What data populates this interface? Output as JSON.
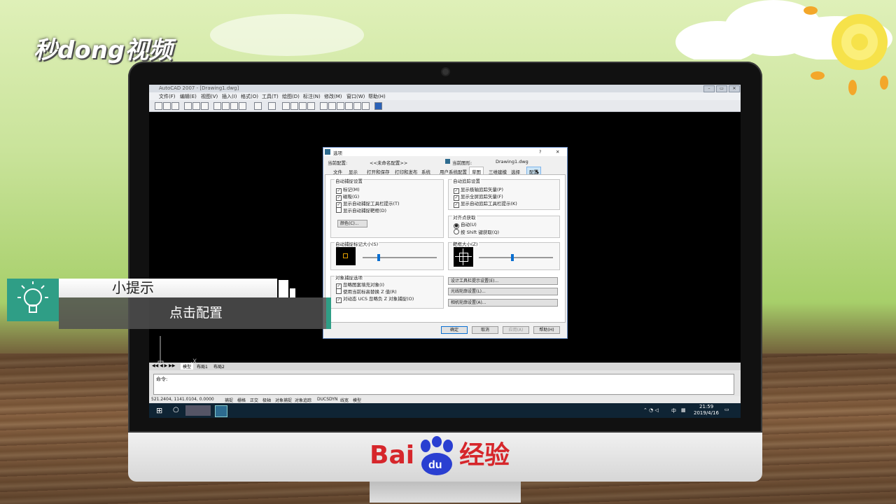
{
  "brand": {
    "logo_text": "秒dong视频",
    "footer_text": "经验",
    "footer_brand": "Bai"
  },
  "app": {
    "window_title": "AutoCAD 2007 - [Drawing1.dwg]",
    "menu": [
      "文件(F)",
      "编辑(E)",
      "视图(V)",
      "插入(I)",
      "格式(O)",
      "工具(T)",
      "绘图(D)",
      "标注(N)",
      "修改(M)",
      "窗口(W)",
      "帮助(H)"
    ],
    "axis_x_label": "X",
    "layout_tabs": [
      "模型",
      "布局1",
      "布局2"
    ],
    "command_prompt": "命令:",
    "status_coords": "521.2404, 1141.0104, 0.0000",
    "status_toggles": [
      "捕捉",
      "栅格",
      "正交",
      "极轴",
      "对象捕捉",
      "对象追踪",
      "DUCS",
      "DYN",
      "线宽",
      "模型"
    ]
  },
  "dialog": {
    "title": "选项",
    "help": "?",
    "close": "✕",
    "current_profile_label": "当前配置:",
    "current_profile_value": "<<未命名配置>>",
    "current_drawing_label": "当前图形:",
    "current_drawing_value": "Drawing1.dwg",
    "tabs": [
      "文件",
      "显示",
      "打开和保存",
      "打印和发布",
      "系统",
      "用户系统配置",
      "草图",
      "三维建模",
      "选择",
      "配置"
    ],
    "autosnap_group": "自动捕捉设置",
    "autosnap_items": [
      "标记(M)",
      "磁吸(G)",
      "显示自动捕捉工具栏提示(T)",
      "显示自动捕捉靶框(D)"
    ],
    "autosnap_checked": [
      true,
      true,
      true,
      false
    ],
    "color_button": "颜色(C)...",
    "autotrack_group": "自动追踪设置",
    "autotrack_items": [
      "显示极轴追踪矢量(P)",
      "显示全屏追踪矢量(F)",
      "显示自动追踪工具栏提示(K)"
    ],
    "autotrack_checked": [
      true,
      true,
      true
    ],
    "align_group": "对齐点获取",
    "align_items": [
      "自动(U)",
      "按 Shift 键获取(Q)"
    ],
    "marker_size_group": "自动捕捉标记大小(S)",
    "aperture_size_group": "靶框大小(Z)",
    "osnap_group": "对象捕捉选项",
    "osnap_items": [
      "忽略图案填充对象(I)",
      "使用当前标高替换 Z 值(R)",
      "对动态 UCS 忽略负 Z 对象捕捉(O)"
    ],
    "osnap_checked": [
      true,
      false,
      true
    ],
    "right_buttons": [
      "设计工具栏提示设置(E)...",
      "光线轮廓设置(L)...",
      "相机轮廓设置(A)..."
    ],
    "footer_buttons": [
      "确定",
      "取消",
      "应用(A)",
      "帮助(H)"
    ]
  },
  "taskbar": {
    "time": "21:59",
    "date": "2019/4/16",
    "ime": "中"
  },
  "tip": {
    "title": "小提示",
    "message": "点击配置"
  }
}
